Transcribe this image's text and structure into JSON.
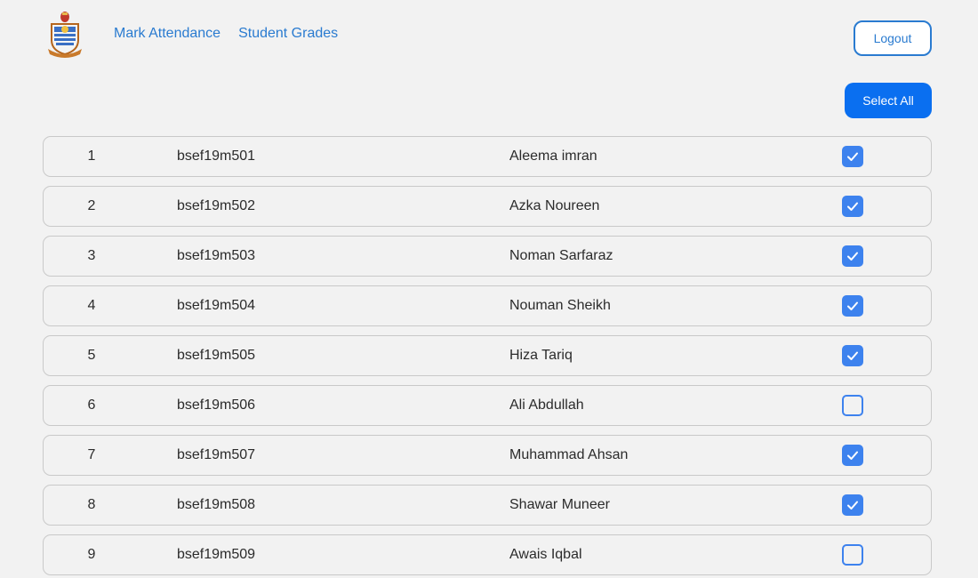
{
  "header": {
    "logo_icon": "university-crest-icon",
    "nav": [
      {
        "label": "Mark Attendance"
      },
      {
        "label": "Student Grades"
      }
    ],
    "logout_label": "Logout"
  },
  "toolbar": {
    "select_all_label": "Select All"
  },
  "colors": {
    "accent": "#0a6ff0",
    "link": "#2a7bd0",
    "checkbox": "#3d82ee",
    "background": "#f2f2f2"
  },
  "students": [
    {
      "no": "1",
      "roll": "bsef19m501",
      "name": "Aleema imran",
      "present": true
    },
    {
      "no": "2",
      "roll": "bsef19m502",
      "name": "Azka Noureen",
      "present": true
    },
    {
      "no": "3",
      "roll": "bsef19m503",
      "name": "Noman Sarfaraz",
      "present": true
    },
    {
      "no": "4",
      "roll": "bsef19m504",
      "name": "Nouman Sheikh",
      "present": true
    },
    {
      "no": "5",
      "roll": "bsef19m505",
      "name": "Hiza Tariq",
      "present": true
    },
    {
      "no": "6",
      "roll": "bsef19m506",
      "name": "Ali Abdullah",
      "present": false
    },
    {
      "no": "7",
      "roll": "bsef19m507",
      "name": "Muhammad Ahsan",
      "present": true
    },
    {
      "no": "8",
      "roll": "bsef19m508",
      "name": "Shawar Muneer",
      "present": true
    },
    {
      "no": "9",
      "roll": "bsef19m509",
      "name": "Awais Iqbal",
      "present": false
    }
  ]
}
